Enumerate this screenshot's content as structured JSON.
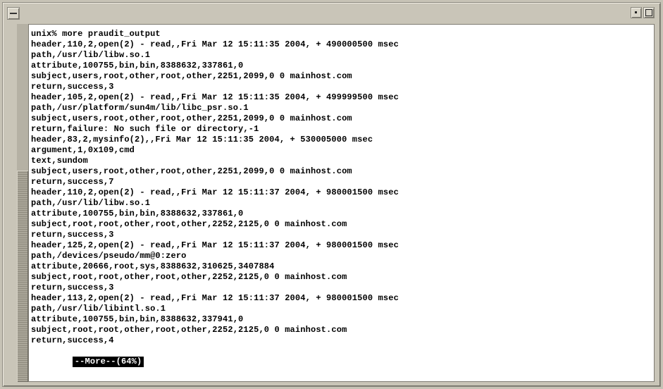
{
  "terminal": {
    "lines": [
      "unix% more praudit_output",
      "header,110,2,open(2) - read,,Fri Mar 12 15:11:35 2004, + 490000500 msec",
      "path,/usr/lib/libw.so.1",
      "attribute,100755,bin,bin,8388632,337861,0",
      "subject,users,root,other,root,other,2251,2099,0 0 mainhost.com",
      "return,success,3",
      "header,105,2,open(2) - read,,Fri Mar 12 15:11:35 2004, + 499999500 msec",
      "path,/usr/platform/sun4m/lib/libc_psr.so.1",
      "subject,users,root,other,root,other,2251,2099,0 0 mainhost.com",
      "return,failure: No such file or directory,-1",
      "header,83,2,mysinfo(2),,Fri Mar 12 15:11:35 2004, + 530005000 msec",
      "argument,1,0x109,cmd",
      "text,sundom",
      "subject,users,root,other,root,other,2251,2099,0 0 mainhost.com",
      "return,success,7",
      "header,110,2,open(2) - read,,Fri Mar 12 15:11:37 2004, + 980001500 msec",
      "path,/usr/lib/libw.so.1",
      "attribute,100755,bin,bin,8388632,337861,0",
      "subject,root,root,other,root,other,2252,2125,0 0 mainhost.com",
      "return,success,3",
      "header,125,2,open(2) - read,,Fri Mar 12 15:11:37 2004, + 980001500 msec",
      "path,/devices/pseudo/mm@0:zero",
      "attribute,20666,root,sys,8388632,310625,3407884",
      "subject,root,root,other,root,other,2252,2125,0 0 mainhost.com",
      "return,success,3",
      "header,113,2,open(2) - read,,Fri Mar 12 15:11:37 2004, + 980001500 msec",
      "path,/usr/lib/libintl.so.1",
      "attribute,100755,bin,bin,8388632,337941,0",
      "subject,root,root,other,root,other,2252,2125,0 0 mainhost.com",
      "return,success,4"
    ],
    "more_prompt": "--More--(64%)"
  },
  "window": {
    "menu_icon": "window-menu-icon",
    "minimize_icon": "minimize-icon",
    "maximize_icon": "maximize-icon"
  }
}
